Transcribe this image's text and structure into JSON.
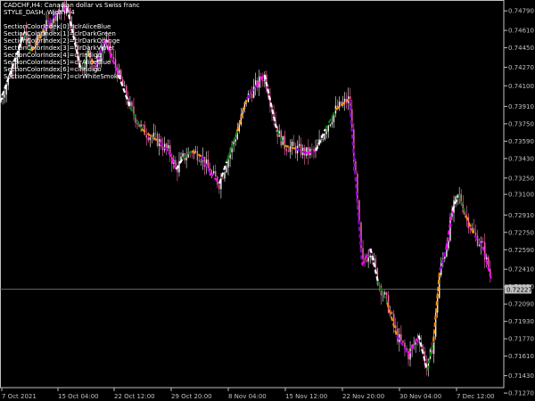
{
  "header": {
    "symbol_line": "CADCHF,H4:  Canadian dollar vs Swiss franc",
    "style_line": "STYLE_DASH,  Width=4"
  },
  "legend": [
    "SectionColorIndex[0]=clrAliceBlue",
    "SectionColorIndex[1]=clrDarkGreen",
    "SectionColorIndex[2]=clrDarkOrange",
    "SectionColorIndex[3]=clrDarkViolet",
    "SectionColorIndex[4]=clrIndigo",
    "SectionColorIndex[5]=clrAliceBlue",
    "SectionColorIndex[6]=clrIndigo",
    "SectionColorIndex[7]=clrWhiteSmoke"
  ],
  "colors": {
    "background": "#000000",
    "axis": "#c0c0c0",
    "candle_bull": "#f5f5f5",
    "candle_bear": "#ff69b4",
    "current_price_bg": "#c0c0c0",
    "zigzag": [
      "#ffffff",
      "#008000",
      "#ff8c00",
      "#9400d3",
      "#ff00ff"
    ]
  },
  "chart_data": {
    "type": "line",
    "symbol": "CADCHF",
    "timeframe": "H4",
    "ylim": [
      0.7132,
      0.7489
    ],
    "y_ticks": [
      "0.74790",
      "0.74610",
      "0.74450",
      "0.74270",
      "0.74100",
      "0.73910",
      "0.73750",
      "0.73590",
      "0.73430",
      "0.73250",
      "0.73100",
      "0.72910",
      "0.72750",
      "0.72590",
      "0.72410",
      "0.72250",
      "0.72090",
      "0.71930",
      "0.71770",
      "0.71610",
      "0.71430",
      "0.71270"
    ],
    "x_ticks": [
      "7 Oct 2021",
      "15 Oct 04:00",
      "22 Oct 12:00",
      "29 Oct 20:00",
      "8 Nov 04:00",
      "15 Nov 12:00",
      "22 Nov 20:00",
      "30 Nov 04:00",
      "7 Dec 12:00"
    ],
    "current_price": "0.72227",
    "current_price_value": 0.72227,
    "zigzag": [
      {
        "t": 0.0,
        "v": 0.7395
      },
      {
        "t": 2.3,
        "v": 0.7458
      },
      {
        "t": 3.0,
        "v": 0.7442
      },
      {
        "t": 4.2,
        "v": 0.7462
      },
      {
        "t": 5.4,
        "v": 0.7477
      },
      {
        "t": 6.4,
        "v": 0.7482
      },
      {
        "t": 7.7,
        "v": 0.7425
      },
      {
        "t": 8.4,
        "v": 0.744
      },
      {
        "t": 9.1,
        "v": 0.7428
      },
      {
        "t": 10.0,
        "v": 0.7452
      },
      {
        "t": 11.3,
        "v": 0.742
      },
      {
        "t": 12.4,
        "v": 0.739
      },
      {
        "t": 13.5,
        "v": 0.737
      },
      {
        "t": 15.2,
        "v": 0.7358
      },
      {
        "t": 16.1,
        "v": 0.7349
      },
      {
        "t": 16.8,
        "v": 0.7333
      },
      {
        "t": 17.4,
        "v": 0.7343
      },
      {
        "t": 18.3,
        "v": 0.735
      },
      {
        "t": 19.2,
        "v": 0.7345
      },
      {
        "t": 20.0,
        "v": 0.733
      },
      {
        "t": 20.9,
        "v": 0.732
      },
      {
        "t": 21.6,
        "v": 0.734
      },
      {
        "t": 22.6,
        "v": 0.7368
      },
      {
        "t": 23.5,
        "v": 0.7398
      },
      {
        "t": 24.4,
        "v": 0.741
      },
      {
        "t": 25.2,
        "v": 0.742
      },
      {
        "t": 26.4,
        "v": 0.7368
      },
      {
        "t": 27.1,
        "v": 0.7355
      },
      {
        "t": 28.2,
        "v": 0.7352
      },
      {
        "t": 29.2,
        "v": 0.7348
      },
      {
        "t": 30.1,
        "v": 0.735
      },
      {
        "t": 31.0,
        "v": 0.737
      },
      {
        "t": 32.0,
        "v": 0.7388
      },
      {
        "t": 33.3,
        "v": 0.7398
      },
      {
        "t": 34.5,
        "v": 0.7245
      },
      {
        "t": 35.3,
        "v": 0.726
      },
      {
        "t": 36.0,
        "v": 0.723
      },
      {
        "t": 36.9,
        "v": 0.721
      },
      {
        "t": 37.8,
        "v": 0.718
      },
      {
        "t": 38.9,
        "v": 0.7162
      },
      {
        "t": 39.9,
        "v": 0.718
      },
      {
        "t": 40.7,
        "v": 0.7148
      },
      {
        "t": 41.3,
        "v": 0.7175
      },
      {
        "t": 41.9,
        "v": 0.724
      },
      {
        "t": 42.5,
        "v": 0.726
      },
      {
        "t": 43.1,
        "v": 0.7295
      },
      {
        "t": 43.7,
        "v": 0.731
      },
      {
        "t": 44.4,
        "v": 0.729
      },
      {
        "t": 45.2,
        "v": 0.7272
      },
      {
        "t": 46.0,
        "v": 0.7262
      },
      {
        "t": 46.8,
        "v": 0.7232
      }
    ]
  }
}
